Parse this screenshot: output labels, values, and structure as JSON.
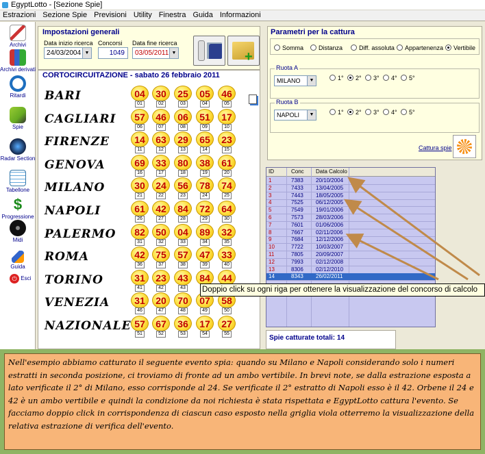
{
  "window": {
    "title": "EgyptLotto - [Sezione Spie]"
  },
  "menu": [
    "Estrazioni",
    "Sezione Spie",
    "Previsioni",
    "Utility",
    "Finestra",
    "Guida",
    "Informazioni"
  ],
  "sidebar": {
    "items": [
      {
        "label": "Archivi",
        "icon": "pencil-icon"
      },
      {
        "label": "Archivi derivati",
        "icon": "books-icon"
      },
      {
        "label": "Ritardi",
        "icon": "clock-icon"
      },
      {
        "label": "Spie",
        "icon": "flashlight-icon"
      },
      {
        "label": "Radar Section",
        "icon": "radar-icon"
      },
      {
        "label": "Tabellone",
        "icon": "calendar-icon"
      },
      {
        "label": "Progressione",
        "icon": "dollar-icon"
      },
      {
        "label": "Midi",
        "icon": "music-icon"
      },
      {
        "label": "Guida",
        "icon": "guide-icon"
      },
      {
        "label": "Esci",
        "icon": "exit-icon"
      }
    ]
  },
  "settings": {
    "title": "Impostazioni generali",
    "start_label": "Data inizio ricerca",
    "start_value": "24/03/2004",
    "conc_label": "Concorsi",
    "conc_value": "1049",
    "end_label": "Data fine ricerca",
    "end_value": "03/05/2011"
  },
  "draw": {
    "title": "CORTOCIRCUITAZIONE - sabato 26 febbraio 2011",
    "wheels": [
      {
        "city": "BARI",
        "nums": [
          "04",
          "30",
          "25",
          "05",
          "46"
        ],
        "pos": [
          "01",
          "02",
          "03",
          "04",
          "05"
        ]
      },
      {
        "city": "CAGLIARI",
        "nums": [
          "57",
          "46",
          "06",
          "51",
          "17"
        ],
        "pos": [
          "06",
          "07",
          "08",
          "09",
          "10"
        ]
      },
      {
        "city": "FIRENZE",
        "nums": [
          "14",
          "63",
          "29",
          "65",
          "23"
        ],
        "pos": [
          "11",
          "12",
          "13",
          "14",
          "15"
        ]
      },
      {
        "city": "GENOVA",
        "nums": [
          "69",
          "33",
          "80",
          "38",
          "61"
        ],
        "pos": [
          "16",
          "17",
          "18",
          "19",
          "20"
        ]
      },
      {
        "city": "MILANO",
        "nums": [
          "30",
          "24",
          "56",
          "78",
          "74"
        ],
        "pos": [
          "21",
          "22",
          "23",
          "24",
          "25"
        ]
      },
      {
        "city": "NAPOLI",
        "nums": [
          "61",
          "42",
          "84",
          "72",
          "64"
        ],
        "pos": [
          "26",
          "27",
          "28",
          "29",
          "30"
        ]
      },
      {
        "city": "PALERMO",
        "nums": [
          "82",
          "50",
          "04",
          "89",
          "32"
        ],
        "pos": [
          "31",
          "32",
          "33",
          "34",
          "35"
        ]
      },
      {
        "city": "ROMA",
        "nums": [
          "42",
          "75",
          "57",
          "47",
          "33"
        ],
        "pos": [
          "36",
          "37",
          "38",
          "39",
          "40"
        ]
      },
      {
        "city": "TORINO",
        "nums": [
          "31",
          "23",
          "43",
          "84",
          "44"
        ],
        "pos": [
          "41",
          "42",
          "43",
          "44",
          "45"
        ]
      },
      {
        "city": "VENEZIA",
        "nums": [
          "31",
          "20",
          "70",
          "07",
          "58"
        ],
        "pos": [
          "46",
          "47",
          "48",
          "49",
          "50"
        ]
      },
      {
        "city": "NAZIONALE",
        "nums": [
          "57",
          "67",
          "36",
          "17",
          "27"
        ],
        "pos": [
          "51",
          "52",
          "53",
          "54",
          "55"
        ]
      }
    ]
  },
  "params": {
    "title": "Parametri per la cattura",
    "modes": [
      "Somma",
      "Distanza",
      "Diff. assoluta",
      "Appartenenza",
      "Vertibile"
    ],
    "selected_mode": "Vertibile",
    "ruota_a": {
      "label": "Ruota A",
      "value": "MILANO"
    },
    "ruota_b": {
      "label": "Ruota B",
      "value": "NAPOLI"
    },
    "positions": [
      "1°",
      "2°",
      "3°",
      "4°",
      "5°"
    ],
    "selected_position": "2°",
    "capture_label": "Cattura spie"
  },
  "grid": {
    "columns": [
      "ID",
      "Conc",
      "Data Calcolo"
    ],
    "rows": [
      [
        "1",
        "7383",
        "20/10/2004"
      ],
      [
        "2",
        "7433",
        "13/04/2005"
      ],
      [
        "3",
        "7443",
        "18/05/2005"
      ],
      [
        "4",
        "7525",
        "06/12/2005"
      ],
      [
        "5",
        "7549",
        "19/01/2006"
      ],
      [
        "6",
        "7573",
        "28/03/2006"
      ],
      [
        "7",
        "7601",
        "01/06/2006"
      ],
      [
        "8",
        "7667",
        "02/11/2006"
      ],
      [
        "9",
        "7684",
        "12/12/2006"
      ],
      [
        "10",
        "7722",
        "10/03/2007"
      ],
      [
        "11",
        "7805",
        "20/09/2007"
      ],
      [
        "12",
        "7993",
        "02/12/2008"
      ],
      [
        "13",
        "8306",
        "02/12/2010"
      ],
      [
        "14",
        "8343",
        "26/02/2011"
      ]
    ],
    "selected_row": 13
  },
  "tooltip": "Doppio click su ogni riga per ottenere la visualizzazione del concorso di calcolo",
  "totals": "Spie catturate totali: 14",
  "note": "Nell'esempio abbiamo catturato il seguente evento spia: quando su Milano e Napoli considerando solo i numeri estratti in seconda posizione, ci troviamo di fronte ad un ambo vertibile. In brevi note, se dalla estrazione esposta a lato verificate il 2° di Milano, esso corrisponde al 24. Se verificate il 2° estratto di Napoli esso è il 42. Orbene il 24 e 42 è un ambo vertibile e quindi la condizione da noi richiesta è stata rispettata e EgyptLotto cattura l'evento. Se facciamo doppio click in corrispondenza di ciascun caso esposto nella griglia viola otterremo la visualizzazione della relativa estrazione di verifica dell'evento."
}
